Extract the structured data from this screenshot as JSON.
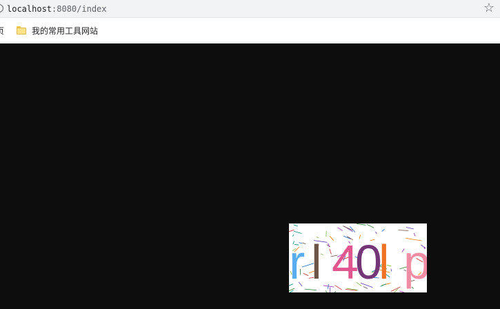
{
  "browser": {
    "url_host": "localhost",
    "url_port_path": ":8080/index",
    "bookmark_cut_text": "页",
    "bookmark_folder_label": "我的常用工具网站"
  },
  "captcha": {
    "chars": [
      {
        "char": "r",
        "color": "#5aaef0"
      },
      {
        "char": "l",
        "color": "#6b5346"
      },
      {
        "char": "4",
        "color": "#e2568f"
      },
      {
        "char": "0",
        "color": "#743677"
      },
      {
        "char": "l",
        "color": "#f07223"
      },
      {
        "char": "p",
        "color": "#f08ca3"
      }
    ],
    "noise_colors": [
      "#2e7d32",
      "#8e24aa",
      "#f57c00",
      "#1565c0",
      "#c62828",
      "#00897b",
      "#6d4c41",
      "#7cb342",
      "#5e35b1"
    ]
  }
}
